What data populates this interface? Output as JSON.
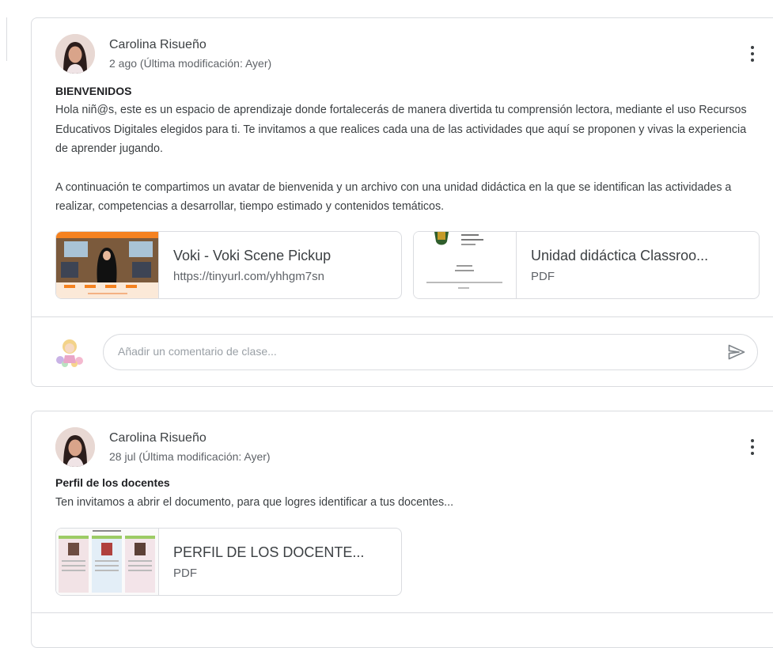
{
  "posts": [
    {
      "author": "Carolina Risueño",
      "meta": "2 ago (Última modificación: Ayer)",
      "title": "BIENVENIDOS",
      "paragraph1": "Hola niñ@s, este es un espacio de aprendizaje donde fortalecerás de manera divertida tu comprensión lectora, mediante el uso Recursos Educativos Digitales elegidos para ti. Te invitamos a que realices cada una de las actividades que aquí se proponen y vivas la experiencia de aprender jugando.",
      "paragraph2": "A continuación te compartimos un avatar de bienvenida y un archivo con una unidad didáctica en la que se identifican las actividades a realizar, competencias a desarrollar, tiempo estimado y contenidos temáticos.",
      "attachments": [
        {
          "title": "Voki - Voki Scene Pickup",
          "subtitle": "https://tinyurl.com/yhhgm7sn"
        },
        {
          "title": "Unidad didáctica Classroo...",
          "subtitle": "PDF"
        }
      ],
      "comment_placeholder": "Añadir un comentario de clase..."
    },
    {
      "author": "Carolina Risueño",
      "meta": "28 jul (Última modificación: Ayer)",
      "title": "Perfil de los docentes",
      "paragraph1": "Ten invitamos a abrir el documento, para que logres identificar a tus docentes...",
      "attachments": [
        {
          "title": "PERFIL DE LOS DOCENTE...",
          "subtitle": "PDF"
        }
      ]
    }
  ],
  "icons": {
    "menu": "more-vert-icon",
    "send": "send-icon"
  },
  "colors": {
    "border": "#dadce0",
    "text": "#3c4043",
    "muted": "#5f6368",
    "voki_orange": "#f58220"
  }
}
